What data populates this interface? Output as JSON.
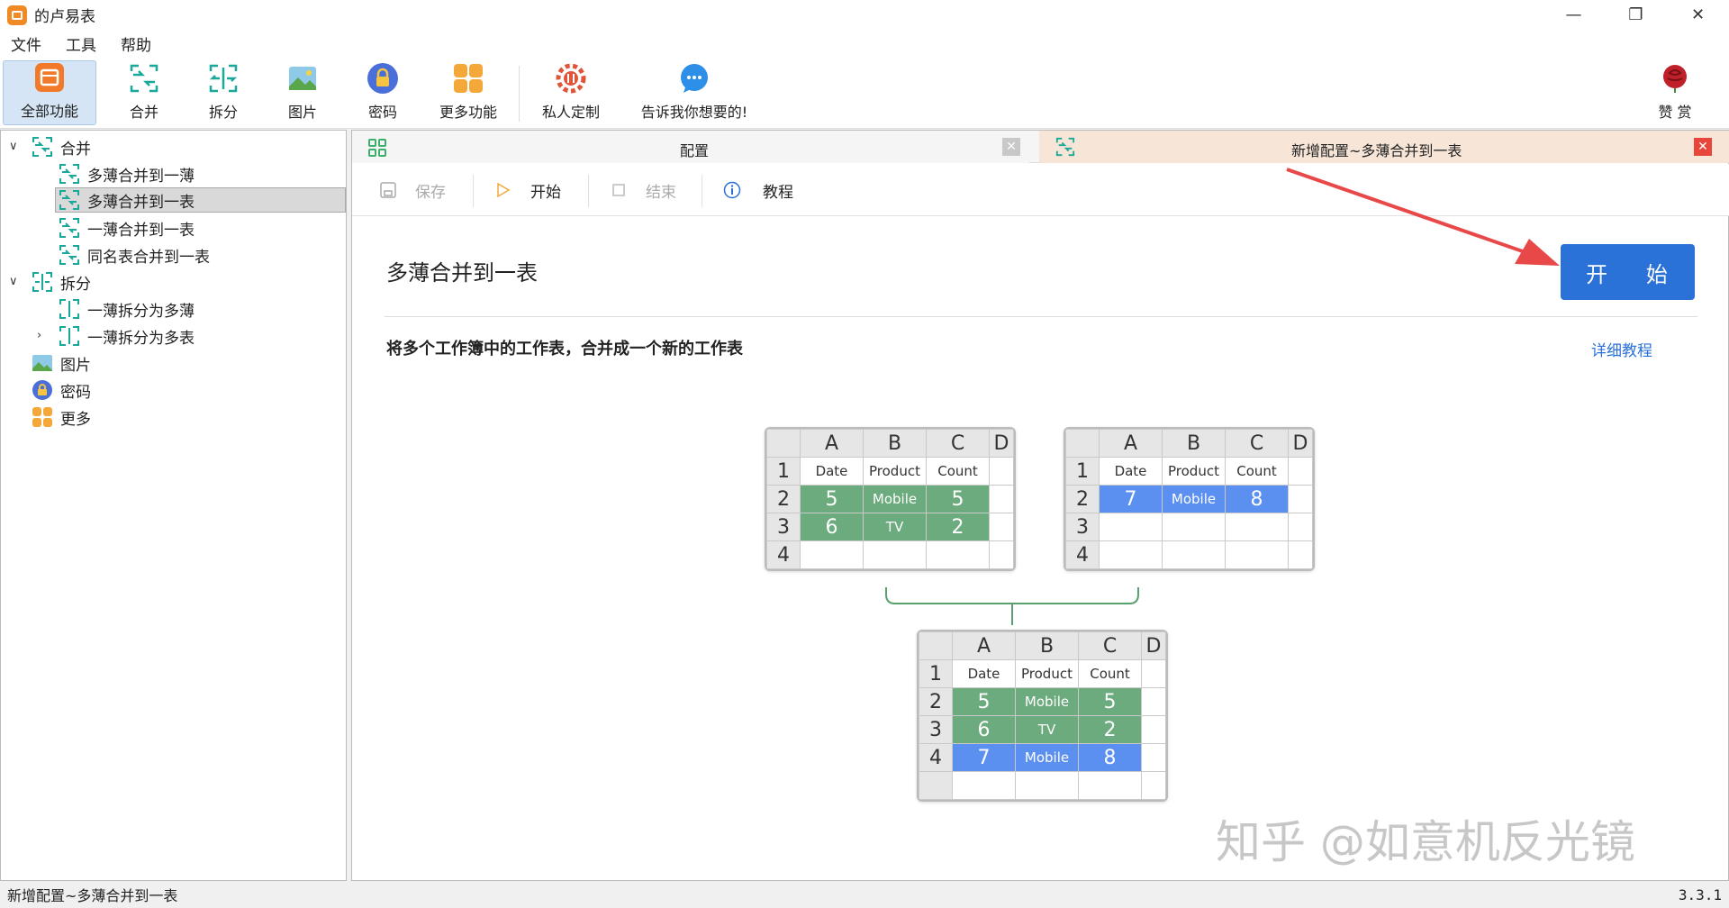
{
  "window": {
    "title": "的卢易表",
    "minimize": "—",
    "restore": "❐",
    "close": "✕"
  },
  "menu": [
    "文件",
    "工具",
    "帮助"
  ],
  "toolbar": {
    "items": [
      "全部功能",
      "合并",
      "拆分",
      "图片",
      "密码",
      "更多功能",
      "私人定制",
      "告诉我你想要的!"
    ],
    "donate": "赞 赏"
  },
  "sidebar": {
    "merge": {
      "label": "合并",
      "children": [
        "多薄合并到一薄",
        "多薄合并到一表",
        "一薄合并到一表",
        "同名表合并到一表"
      ]
    },
    "split": {
      "label": "拆分",
      "children": [
        "一薄拆分为多薄",
        "一薄拆分为多表"
      ]
    },
    "picture": "图片",
    "password": "密码",
    "more": "更多"
  },
  "tabs": {
    "config": "配置",
    "new_config": "新增配置~多薄合并到一表"
  },
  "subtoolbar": {
    "save": "保存",
    "start": "开始",
    "end": "结束",
    "tutorial": "教程"
  },
  "content": {
    "heading": "多薄合并到一表",
    "start_button": "开 始",
    "description": "将多个工作簿中的工作表，合并成一个新的工作表",
    "tutorial_link": "详细教程"
  },
  "sheets": {
    "columns": [
      "A",
      "B",
      "C",
      "D"
    ],
    "header_row": [
      "Date",
      "Product",
      "Count"
    ],
    "sheet1": {
      "rows": [
        [
          "5",
          "Mobile",
          "5"
        ],
        [
          "6",
          "TV",
          "2"
        ]
      ]
    },
    "sheet2": {
      "rows": [
        [
          "7",
          "Mobile",
          "8"
        ]
      ]
    },
    "result": {
      "rows": [
        [
          "5",
          "Mobile",
          "5"
        ],
        [
          "6",
          "TV",
          "2"
        ],
        [
          "7",
          "Mobile",
          "8"
        ]
      ]
    }
  },
  "colors": {
    "accent": "#2a71d8",
    "green_cell": "#6bab7d",
    "blue_cell": "#5b8ff0",
    "arrow": "#e84848"
  },
  "statusbar": {
    "left": "新增配置~多薄合并到一表",
    "version": "3.3.1"
  },
  "watermark": "知乎 @如意机反光镜"
}
